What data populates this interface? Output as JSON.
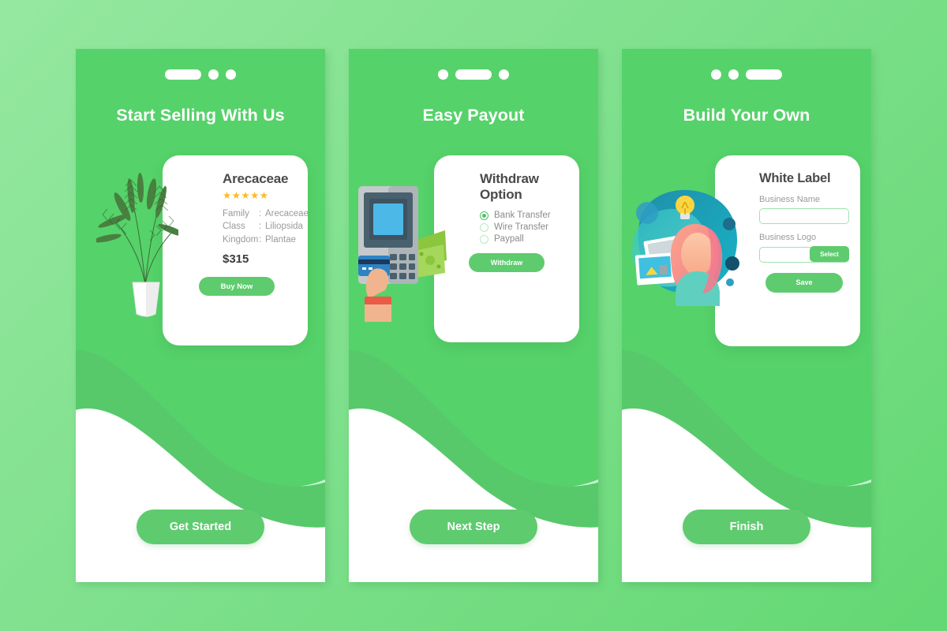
{
  "theme": {
    "bg_gradient_from": "#95e8a0",
    "bg_gradient_to": "#63d873",
    "panel_green": "#56d26a",
    "wave_dark_green": "#57c96b",
    "wave_mint": "#c9f2d2",
    "accent_button": "#5ecb6f",
    "star_gold": "#fbba25",
    "card_white": "#ffffff",
    "text_dark": "#4a4a4a",
    "text_muted": "#9a9a9a"
  },
  "screens": [
    {
      "id": "start-selling",
      "title": "Start Selling With Us",
      "pager": [
        "active",
        "dot",
        "dot"
      ],
      "illustration": "potted-palm-plant",
      "card": {
        "title": "Arecaceae",
        "rating_stars": "★★★★★",
        "rating_value": 5,
        "specs": [
          {
            "key": "Family",
            "sep": ":",
            "value": "Arecaceae"
          },
          {
            "key": "Class",
            "sep": ":",
            "value": "Liliopsida"
          },
          {
            "key": "Kingdom",
            "sep": ":",
            "value": "Plantae"
          }
        ],
        "price": "$315",
        "button": "Buy Now"
      },
      "cta": "Get Started"
    },
    {
      "id": "easy-payout",
      "title": "Easy Payout",
      "pager": [
        "dot",
        "active",
        "dot"
      ],
      "illustration": "atm-machine-with-card-and-cash",
      "card": {
        "title_line1": "Withdraw",
        "title_line2": "Option",
        "options": [
          {
            "label": "Bank Transfer",
            "selected": true
          },
          {
            "label": "Wire Transfer",
            "selected": false
          },
          {
            "label": "Paypall",
            "selected": false
          }
        ],
        "button": "Withdraw"
      },
      "cta": "Next Step"
    },
    {
      "id": "build-your-own",
      "title": "Build Your Own",
      "pager": [
        "dot",
        "dot",
        "active"
      ],
      "illustration": "creative-woman-with-lightbulb-and-photos",
      "card": {
        "title": "White Label",
        "fields": [
          {
            "label": "Business Name",
            "value": "",
            "placeholder": ""
          },
          {
            "label": "Business Logo",
            "value": "",
            "placeholder": "",
            "action": "Select"
          }
        ],
        "button": "Save"
      },
      "cta": "Finish"
    }
  ]
}
